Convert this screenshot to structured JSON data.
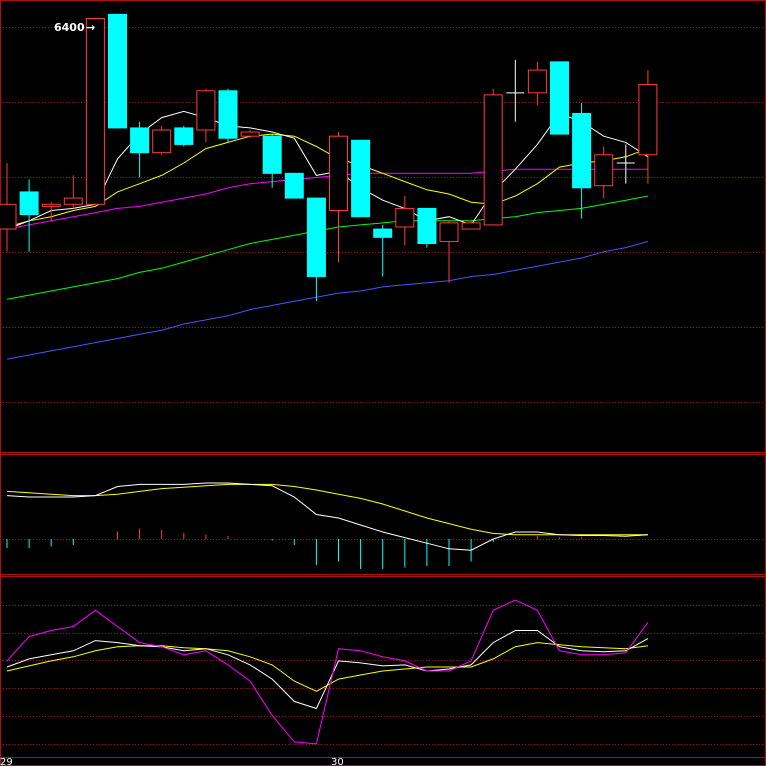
{
  "chart_data": [
    {
      "type": "candlestick",
      "panel": "price",
      "annotation": "6400",
      "x_labels": [
        "29",
        "30"
      ],
      "colors": {
        "up": "#ff3b3b",
        "down": "#00ffff",
        "ma5": "#ffffff",
        "ma10": "#ffff00",
        "ma20": "#ff00ff",
        "ma40": "#00ff00",
        "ma60": "#5050ff",
        "grid": "#b01010"
      },
      "candles": [
        {
          "x": 0,
          "o": 1500,
          "h": 1700,
          "l": 1270,
          "c": 1380,
          "dir": "up"
        },
        {
          "x": 1,
          "o": 1560,
          "h": 1620,
          "l": 1270,
          "c": 1450,
          "dir": "down"
        },
        {
          "x": 2,
          "o": 1490,
          "h": 1510,
          "l": 1420,
          "c": 1500,
          "dir": "up"
        },
        {
          "x": 3,
          "o": 1500,
          "h": 1640,
          "l": 1480,
          "c": 1530,
          "dir": "up"
        },
        {
          "x": 4,
          "o": 2400,
          "h": 2400,
          "l": 1500,
          "c": 1500,
          "dir": "up"
        },
        {
          "x": 5,
          "o": 2420,
          "h": 2420,
          "l": 1870,
          "c": 1870,
          "dir": "down"
        },
        {
          "x": 6,
          "o": 1870,
          "h": 1900,
          "l": 1630,
          "c": 1750,
          "dir": "down"
        },
        {
          "x": 7,
          "o": 1750,
          "h": 1880,
          "l": 1740,
          "c": 1860,
          "dir": "up"
        },
        {
          "x": 8,
          "o": 1870,
          "h": 1880,
          "l": 1780,
          "c": 1790,
          "dir": "down"
        },
        {
          "x": 9,
          "o": 1860,
          "h": 2060,
          "l": 1800,
          "c": 2050,
          "dir": "up"
        },
        {
          "x": 10,
          "o": 2050,
          "h": 2060,
          "l": 1800,
          "c": 1820,
          "dir": "down"
        },
        {
          "x": 11,
          "o": 1830,
          "h": 1860,
          "l": 1820,
          "c": 1850,
          "dir": "up"
        },
        {
          "x": 12,
          "o": 1830,
          "h": 1840,
          "l": 1580,
          "c": 1650,
          "dir": "down"
        },
        {
          "x": 13,
          "o": 1650,
          "h": 1650,
          "l": 1530,
          "c": 1530,
          "dir": "down"
        },
        {
          "x": 14,
          "o": 1530,
          "h": 1530,
          "l": 1030,
          "c": 1150,
          "dir": "down"
        },
        {
          "x": 15,
          "o": 1470,
          "h": 1850,
          "l": 1220,
          "c": 1830,
          "dir": "up"
        },
        {
          "x": 16,
          "o": 1810,
          "h": 1810,
          "l": 1440,
          "c": 1440,
          "dir": "down"
        },
        {
          "x": 17,
          "o": 1340,
          "h": 1400,
          "l": 1150,
          "c": 1380,
          "dir": "down"
        },
        {
          "x": 18,
          "o": 1390,
          "h": 1540,
          "l": 1300,
          "c": 1480,
          "dir": "up"
        },
        {
          "x": 19,
          "o": 1480,
          "h": 1480,
          "l": 1290,
          "c": 1310,
          "dir": "down"
        },
        {
          "x": 20,
          "o": 1320,
          "h": 1420,
          "l": 1120,
          "c": 1410,
          "dir": "up"
        },
        {
          "x": 21,
          "o": 1380,
          "h": 1420,
          "l": 1380,
          "c": 1410,
          "dir": "up"
        },
        {
          "x": 22,
          "o": 1400,
          "h": 2060,
          "l": 1400,
          "c": 2030,
          "dir": "up"
        },
        {
          "x": 23,
          "o": 2040,
          "h": 2200,
          "l": 1900,
          "c": 2040,
          "dir": "doji"
        },
        {
          "x": 24,
          "o": 2040,
          "h": 2190,
          "l": 1980,
          "c": 2150,
          "dir": "up"
        },
        {
          "x": 25,
          "o": 2190,
          "h": 2190,
          "l": 1840,
          "c": 1840,
          "dir": "down"
        },
        {
          "x": 26,
          "o": 1940,
          "h": 1990,
          "l": 1430,
          "c": 1580,
          "dir": "down"
        },
        {
          "x": 27,
          "o": 1590,
          "h": 1780,
          "l": 1530,
          "c": 1740,
          "dir": "up"
        },
        {
          "x": 28,
          "o": 1700,
          "h": 1790,
          "l": 1600,
          "c": 1700,
          "dir": "doji"
        },
        {
          "x": 29,
          "o": 1740,
          "h": 2150,
          "l": 1600,
          "c": 2080,
          "dir": "up"
        }
      ],
      "ma5": [
        1380,
        1420,
        1470,
        1480,
        1500,
        1720,
        1840,
        1920,
        1950,
        1920,
        1880,
        1870,
        1850,
        1820,
        1640,
        1660,
        1580,
        1520,
        1480,
        1420,
        1440,
        1400,
        1560,
        1670,
        1790,
        1940,
        1900,
        1830,
        1800,
        1730
      ],
      "ma10": [
        1390,
        1420,
        1440,
        1470,
        1490,
        1560,
        1600,
        1640,
        1700,
        1770,
        1800,
        1830,
        1840,
        1830,
        1780,
        1720,
        1690,
        1650,
        1610,
        1570,
        1550,
        1510,
        1500,
        1540,
        1600,
        1680,
        1700,
        1710,
        1730,
        1770
      ],
      "ma20": [
        1380,
        1400,
        1420,
        1440,
        1460,
        1480,
        1490,
        1510,
        1530,
        1550,
        1580,
        1600,
        1610,
        1620,
        1630,
        1640,
        1650,
        1650,
        1650,
        1650,
        1650,
        1650,
        1660,
        1670,
        1670,
        1670,
        1670,
        1670,
        1670,
        1670
      ],
      "ma40": [
        1040,
        1060,
        1080,
        1100,
        1120,
        1140,
        1170,
        1190,
        1220,
        1250,
        1280,
        1310,
        1330,
        1350,
        1370,
        1390,
        1400,
        1410,
        1420,
        1420,
        1420,
        1420,
        1430,
        1440,
        1460,
        1470,
        1480,
        1500,
        1520,
        1540
      ],
      "ma60": [
        750,
        770,
        790,
        810,
        830,
        850,
        870,
        890,
        920,
        940,
        960,
        990,
        1010,
        1030,
        1050,
        1070,
        1080,
        1100,
        1110,
        1120,
        1130,
        1150,
        1160,
        1180,
        1200,
        1220,
        1240,
        1270,
        1290,
        1320
      ]
    },
    {
      "type": "macd",
      "panel": "macd",
      "dif": [
        0.62,
        0.6,
        0.6,
        0.6,
        0.62,
        0.75,
        0.78,
        0.78,
        0.78,
        0.8,
        0.8,
        0.78,
        0.76,
        0.6,
        0.35,
        0.3,
        0.2,
        0.1,
        0.02,
        -0.06,
        -0.14,
        -0.16,
        0.0,
        0.1,
        0.1,
        0.06,
        0.05,
        0.05,
        0.04,
        0.06
      ],
      "dea": [
        0.68,
        0.66,
        0.64,
        0.62,
        0.62,
        0.64,
        0.68,
        0.72,
        0.74,
        0.76,
        0.78,
        0.78,
        0.78,
        0.75,
        0.7,
        0.64,
        0.58,
        0.5,
        0.4,
        0.3,
        0.22,
        0.14,
        0.08,
        0.06,
        0.06,
        0.06,
        0.06,
        0.06,
        0.06,
        0.06
      ],
      "hist": [
        -0.12,
        -0.12,
        -0.1,
        -0.08,
        0,
        0.1,
        0.14,
        0.12,
        0.08,
        0.06,
        0.04,
        0,
        -0.02,
        -0.08,
        -0.35,
        -0.3,
        -0.4,
        -0.4,
        -0.38,
        -0.36,
        -0.36,
        -0.3,
        -0.04,
        0.02,
        0.04,
        0.02,
        0.02,
        0,
        0,
        0
      ]
    },
    {
      "type": "kdj",
      "panel": "kdj",
      "k": [
        44,
        52,
        56,
        60,
        70,
        68,
        65,
        64,
        60,
        62,
        56,
        46,
        32,
        10,
        3,
        50,
        48,
        45,
        46,
        40,
        42,
        46,
        68,
        80,
        80,
        64,
        60,
        59,
        60,
        72
      ],
      "d": [
        40,
        45,
        50,
        54,
        60,
        64,
        65,
        65,
        63,
        62,
        60,
        54,
        46,
        30,
        20,
        32,
        36,
        40,
        42,
        44,
        44,
        44,
        52,
        64,
        68,
        66,
        64,
        63,
        62,
        65
      ],
      "j": [
        50,
        74,
        80,
        84,
        100,
        84,
        68,
        64,
        56,
        60,
        46,
        30,
        -4,
        -30,
        -32,
        62,
        60,
        54,
        50,
        40,
        40,
        50,
        100,
        110,
        100,
        60,
        56,
        56,
        58,
        88
      ]
    }
  ]
}
